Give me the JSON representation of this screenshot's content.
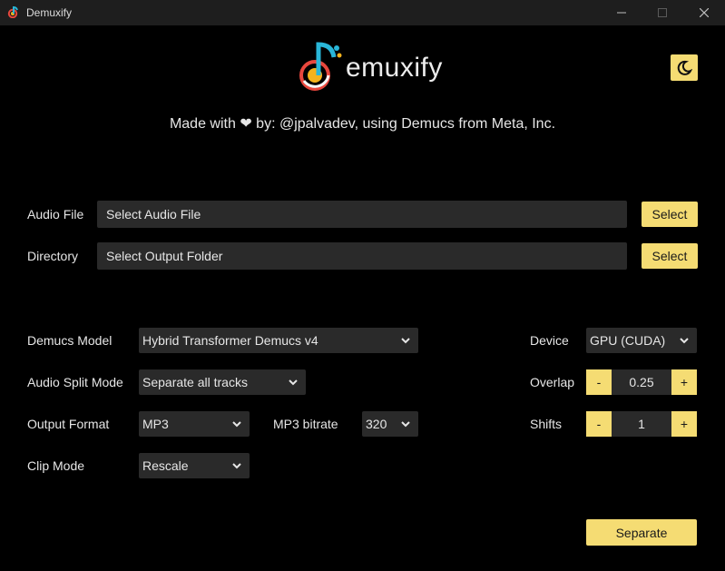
{
  "window": {
    "title": "Demuxify",
    "controls": {
      "minimize": "─",
      "maximize": "☐",
      "close": "✕"
    }
  },
  "header": {
    "logo_text": "emuxify",
    "tagline": "Made with ❤ by: @jpalvadev, using Demucs from Meta, Inc.",
    "theme_icon": "moon-icon"
  },
  "files": {
    "audio_label": "Audio File",
    "audio_value": "Select Audio File",
    "audio_button": "Select",
    "directory_label": "Directory",
    "directory_value": "Select Output Folder",
    "directory_button": "Select"
  },
  "options": {
    "model_label": "Demucs Model",
    "model_value": "Hybrid Transformer Demucs v4",
    "split_label": "Audio Split Mode",
    "split_value": "Separate all tracks",
    "format_label": "Output Format",
    "format_value": "MP3",
    "bitrate_label": "MP3 bitrate",
    "bitrate_value": "320",
    "clip_label": "Clip Mode",
    "clip_value": "Rescale",
    "device_label": "Device",
    "device_value": "GPU (CUDA)",
    "overlap_label": "Overlap",
    "overlap_value": "0.25",
    "shifts_label": "Shifts",
    "shifts_value": "1",
    "minus": "-",
    "plus": "+"
  },
  "actions": {
    "separate_label": "Separate"
  },
  "colors": {
    "accent": "#f5dc73",
    "field_bg": "#2a2a2a",
    "background": "#000000",
    "titlebar": "#1e1e1e"
  }
}
